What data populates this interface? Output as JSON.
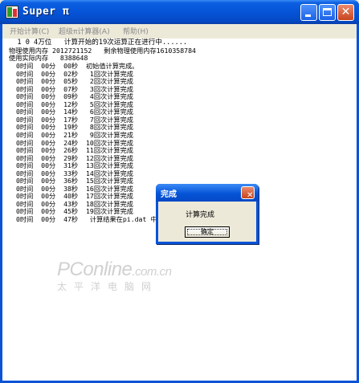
{
  "window": {
    "title": "Super π",
    "icon": "superpi-app-icon"
  },
  "titlebar_buttons": {
    "minimize": "minimize-icon",
    "maximize": "maximize-icon",
    "close": "close-icon"
  },
  "menu": {
    "items": [
      {
        "label": "开始计算(C)",
        "enabled": false
      },
      {
        "label": "超级π计算器(A)",
        "enabled": false
      },
      {
        "label": "帮助(H)",
        "enabled": false
      }
    ]
  },
  "log": {
    "header_lines": [
      "  1 0 4万位   计算开始的19次运算正在进行中......",
      "物理使用内存 2012721152   剩余物理使用内存1610358784",
      "使用实际内存   8388648"
    ],
    "entries": [
      "0时间  00分  00秒  初始值计算完成。",
      "0时间  00分  02秒   1回次计算完成",
      "0时间  00分  05秒   2回次计算完成",
      "0时间  00分  07秒   3回次计算完成",
      "0时间  00分  09秒   4回次计算完成",
      "0时间  00分  12秒   5回次计算完成",
      "0时间  00分  14秒   6回次计算完成",
      "0时间  00分  17秒   7回次计算完成",
      "0时间  00分  19秒   8回次计算完成",
      "0时间  00分  21秒   9回次计算完成",
      "0时间  00分  24秒  10回次计算完成",
      "0时间  00分  26秒  11回次计算完成",
      "0时间  00分  29秒  12回次计算完成",
      "0时间  00分  31秒  13回次计算完成",
      "0时间  00分  33秒  14回次计算完成",
      "0时间  00分  36秒  15回次计算完成",
      "0时间  00分  38秒  16回次计算完成",
      "0时间  00分  40秒  17回次计算完成",
      "0时间  00分  43秒  18回次计算完成",
      "0时间  00分  45秒  19回次计算完成",
      "0时间  00分  47秒   计算结果在pi.dat 中记"
    ]
  },
  "watermark": {
    "line1": "PConline",
    "line1_suffix": ".com.cn",
    "line2": "太平洋电脑网"
  },
  "dialog": {
    "title": "完成",
    "message": "计算完成",
    "ok_label": "确定",
    "close_icon": "close-icon"
  },
  "colors": {
    "titlebar": "#0654d8",
    "close_button": "#c8441c",
    "menu_disabled_text": "#8a8a8a",
    "watermark": "#d0d0d0"
  }
}
